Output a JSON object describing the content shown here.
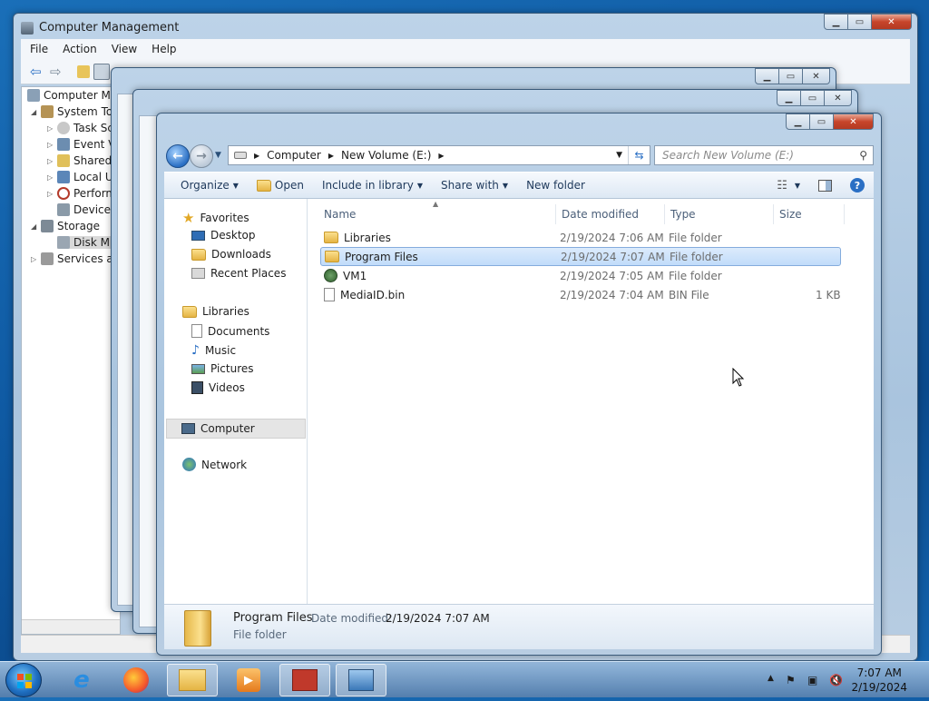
{
  "computer_management": {
    "title": "Computer Management",
    "menu": [
      "File",
      "Action",
      "View",
      "Help"
    ],
    "tree": [
      {
        "label": "Computer Ma",
        "indent": 0,
        "twisty": ""
      },
      {
        "label": "System To",
        "indent": 1,
        "twisty": "◢"
      },
      {
        "label": "Task Sc",
        "indent": 2,
        "twisty": "▷"
      },
      {
        "label": "Event V",
        "indent": 2,
        "twisty": "▷"
      },
      {
        "label": "Shared",
        "indent": 2,
        "twisty": "▷"
      },
      {
        "label": "Local U",
        "indent": 2,
        "twisty": "▷"
      },
      {
        "label": "Perform",
        "indent": 2,
        "twisty": "▷"
      },
      {
        "label": "Device",
        "indent": 2,
        "twisty": ""
      },
      {
        "label": "Storage",
        "indent": 1,
        "twisty": "◢"
      },
      {
        "label": "Disk M",
        "indent": 2,
        "twisty": ""
      },
      {
        "label": "Services an",
        "indent": 1,
        "twisty": "▷"
      }
    ]
  },
  "explorer": {
    "address": {
      "root_icon": "drive-icon",
      "crumbs": [
        "Computer",
        "New Volume (E:)"
      ]
    },
    "search_placeholder": "Search New Volume (E:)",
    "commands": {
      "organize": "Organize",
      "open": "Open",
      "include": "Include in library",
      "share": "Share with",
      "new_folder": "New folder"
    },
    "nav": {
      "favorites": "Favorites",
      "desktop": "Desktop",
      "downloads": "Downloads",
      "recent": "Recent Places",
      "libraries": "Libraries",
      "documents": "Documents",
      "music": "Music",
      "pictures": "Pictures",
      "videos": "Videos",
      "computer": "Computer",
      "network": "Network"
    },
    "columns": {
      "name": "Name",
      "date": "Date modified",
      "type": "Type",
      "size": "Size"
    },
    "files": [
      {
        "name": "Libraries",
        "date": "2/19/2024 7:06 AM",
        "type": "File folder",
        "size": "",
        "icon": "folder-icon"
      },
      {
        "name": "Program Files",
        "date": "2/19/2024 7:07 AM",
        "type": "File folder",
        "size": "",
        "icon": "folder-icon"
      },
      {
        "name": "VM1",
        "date": "2/19/2024 7:05 AM",
        "type": "File folder",
        "size": "",
        "icon": "vm-folder-icon"
      },
      {
        "name": "MediaID.bin",
        "date": "2/19/2024 7:04 AM",
        "type": "BIN File",
        "size": "1 KB",
        "icon": "file-icon"
      }
    ],
    "details": {
      "name": "Program Files",
      "date_label": "Date modified:",
      "date_value": "2/19/2024 7:07 AM",
      "type": "File folder"
    }
  },
  "taskbar": {
    "time": "7:07 AM",
    "date": "2/19/2024"
  },
  "colors": {
    "accent": "#2a6fc4",
    "selection": "#c1dcfa",
    "close": "#c7452b"
  }
}
